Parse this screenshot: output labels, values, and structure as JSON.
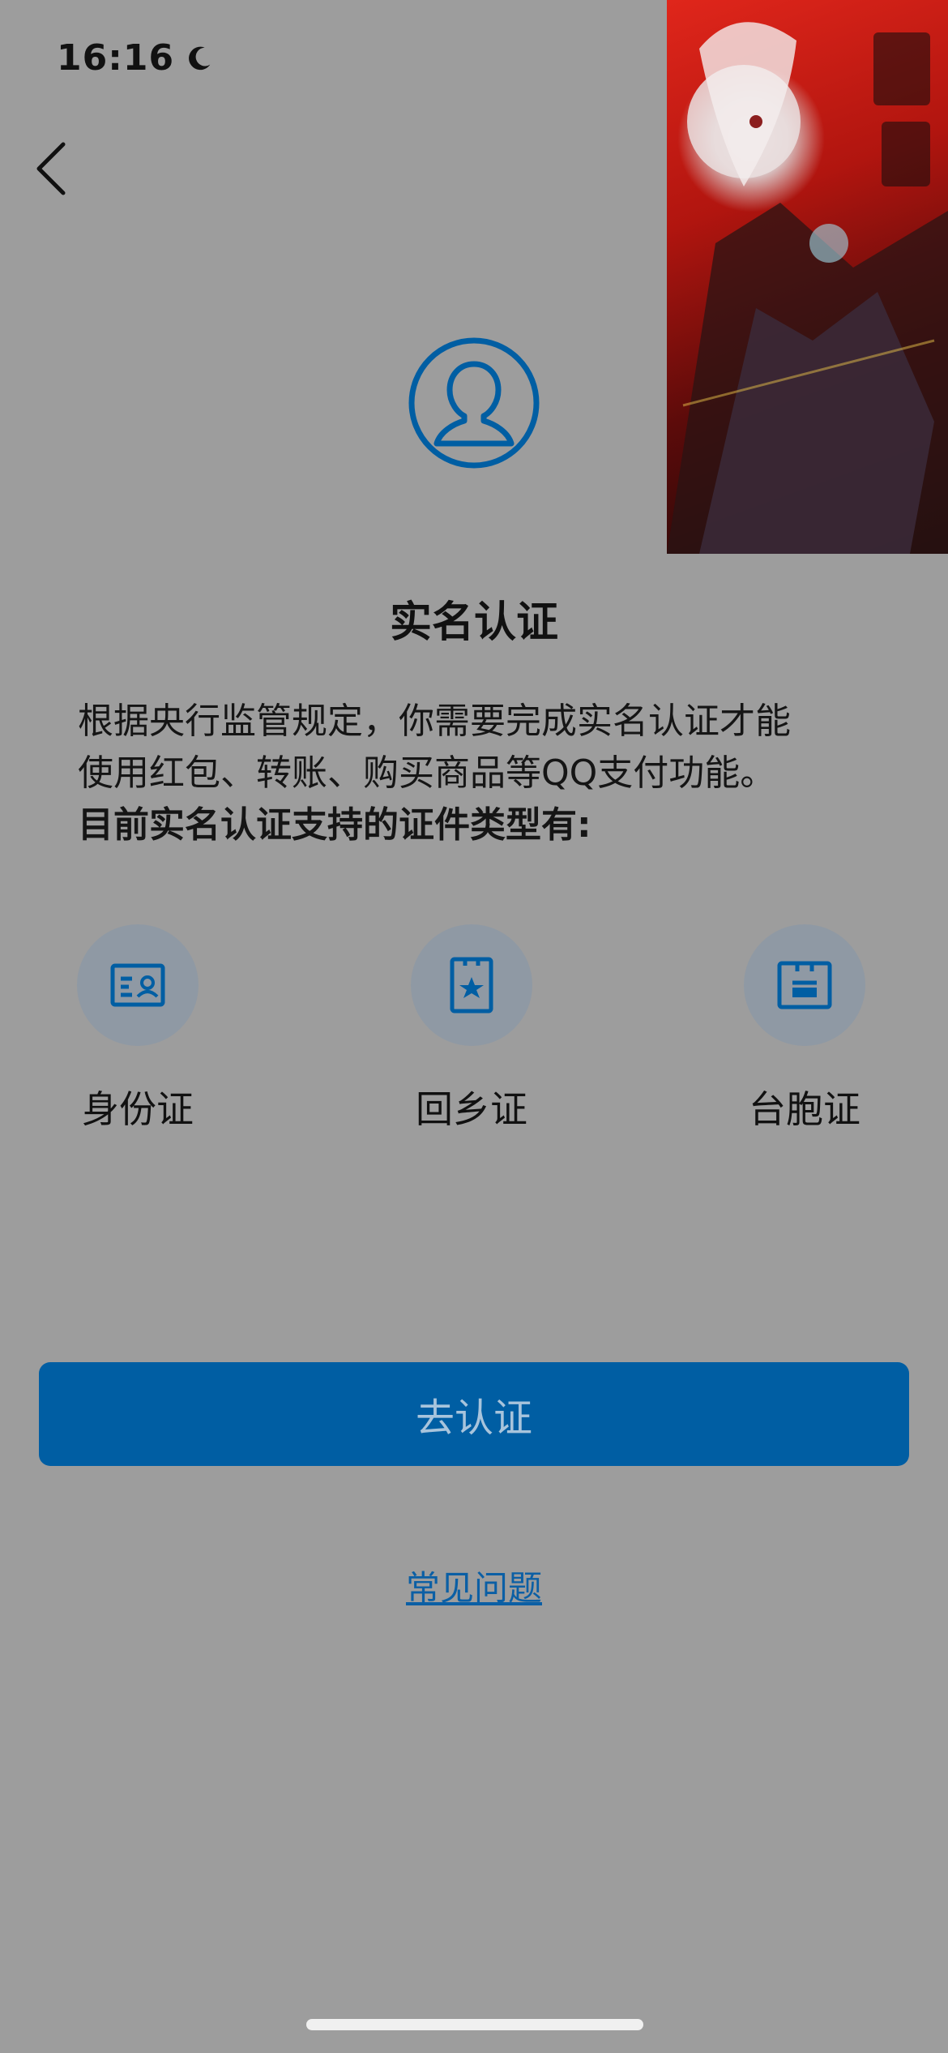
{
  "status_bar": {
    "time": "16:16",
    "icon": "moon-icon"
  },
  "header": {
    "back_icon": "chevron-left-icon"
  },
  "page": {
    "title": "实名认证",
    "desc_line1": "根据央行监管规定，你需要完成实名认证才能",
    "desc_line2": "使用红包、转账、购买商品等QQ支付功能。",
    "desc_bold": "目前实名认证支持的证件类型有:"
  },
  "doc_types": [
    {
      "label": "身份证",
      "icon": "id-card-icon"
    },
    {
      "label": "回乡证",
      "icon": "home-return-permit-icon"
    },
    {
      "label": "台胞证",
      "icon": "taiwan-compatriot-permit-icon"
    }
  ],
  "actions": {
    "verify_label": "去认证",
    "faq_label": "常见问题"
  },
  "colors": {
    "background": "#9d9d9d",
    "accent": "#005ea3",
    "icon_blue": "#0b5fa5"
  }
}
